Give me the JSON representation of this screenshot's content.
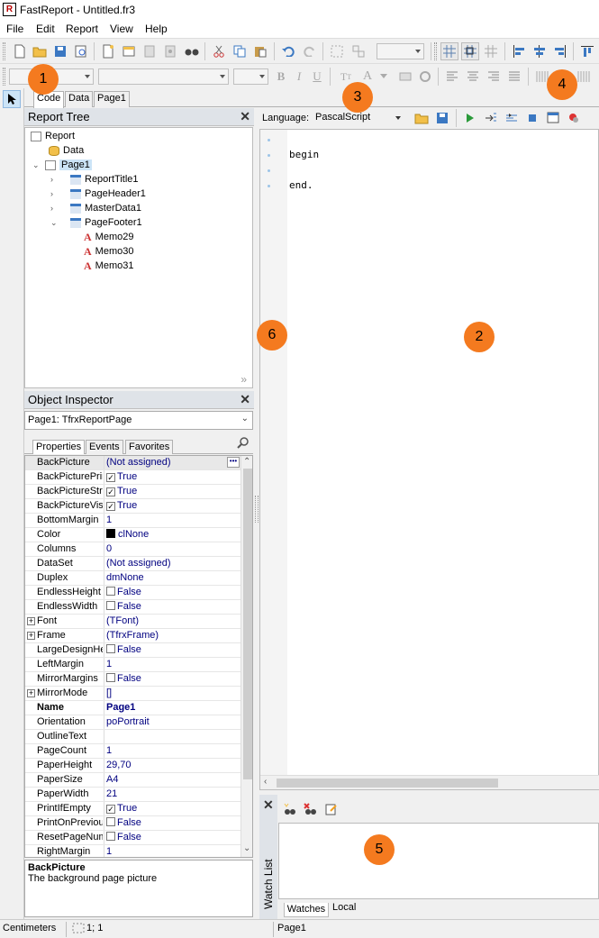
{
  "window": {
    "title": "FastReport - Untitled.fr3"
  },
  "menu": [
    "File",
    "Edit",
    "Report",
    "View",
    "Help"
  ],
  "page_tabs": [
    "Code",
    "Data",
    "Page1"
  ],
  "callouts": [
    "1",
    "2",
    "3",
    "4",
    "5",
    "6"
  ],
  "report_tree": {
    "title": "Report Tree",
    "nodes": [
      "Report",
      "Data",
      "Page1",
      "ReportTitle1",
      "PageHeader1",
      "MasterData1",
      "PageFooter1",
      "Memo29",
      "Memo30",
      "Memo31"
    ]
  },
  "object_inspector": {
    "title": "Object Inspector",
    "selected_object": "Page1: TfrxReportPage",
    "tabs": [
      "Properties",
      "Events",
      "Favorites"
    ],
    "props": [
      {
        "name": "BackPicture",
        "value": "(Not assigned)"
      },
      {
        "name": "BackPicturePrintable",
        "value": "True"
      },
      {
        "name": "BackPictureStretched",
        "value": "True"
      },
      {
        "name": "BackPictureVisible",
        "value": "True"
      },
      {
        "name": "BottomMargin",
        "value": "1"
      },
      {
        "name": "Color",
        "value": "clNone"
      },
      {
        "name": "Columns",
        "value": "0"
      },
      {
        "name": "DataSet",
        "value": "(Not assigned)"
      },
      {
        "name": "Duplex",
        "value": "dmNone"
      },
      {
        "name": "EndlessHeight",
        "value": "False"
      },
      {
        "name": "EndlessWidth",
        "value": "False"
      },
      {
        "name": "Font",
        "value": "(TFont)"
      },
      {
        "name": "Frame",
        "value": "(TfrxFrame)"
      },
      {
        "name": "LargeDesignHeight",
        "value": "False"
      },
      {
        "name": "LeftMargin",
        "value": "1"
      },
      {
        "name": "MirrorMargins",
        "value": "False"
      },
      {
        "name": "MirrorMode",
        "value": "[]"
      },
      {
        "name": "Name",
        "value": "Page1"
      },
      {
        "name": "Orientation",
        "value": "poPortrait"
      },
      {
        "name": "OutlineText",
        "value": ""
      },
      {
        "name": "PageCount",
        "value": "1"
      },
      {
        "name": "PaperHeight",
        "value": "29,70"
      },
      {
        "name": "PaperSize",
        "value": "A4"
      },
      {
        "name": "PaperWidth",
        "value": "21"
      },
      {
        "name": "PrintIfEmpty",
        "value": "True"
      },
      {
        "name": "PrintOnPreviousPage",
        "value": "False"
      },
      {
        "name": "ResetPageNumbers",
        "value": "False"
      },
      {
        "name": "RightMargin",
        "value": "1"
      }
    ],
    "description_title": "BackPicture",
    "description_text": "The background page picture"
  },
  "code": {
    "language_label": "Language:",
    "language_value": "PascalScript",
    "lines": [
      "begin",
      "end."
    ]
  },
  "watch": {
    "title": "Watch List",
    "tabs": [
      "Watches",
      "Local"
    ]
  },
  "status": {
    "units": "Centimeters",
    "position": "1; 1",
    "page": "Page1"
  },
  "colors": {
    "callout": "#f47a1f",
    "selection": "#cce4f7"
  }
}
